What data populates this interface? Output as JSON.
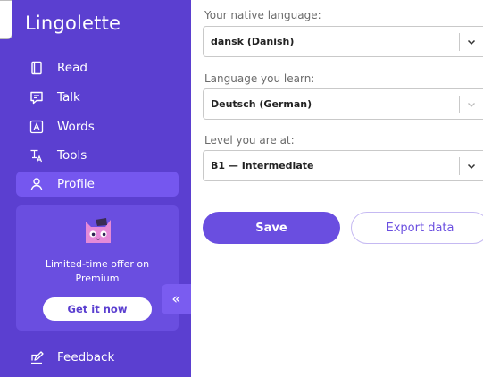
{
  "app": {
    "name": "Lingolette"
  },
  "sidebar": {
    "items": [
      {
        "label": "Read",
        "icon": "book-icon"
      },
      {
        "label": "Talk",
        "icon": "chat-icon"
      },
      {
        "label": "Words",
        "icon": "letter-a-icon"
      },
      {
        "label": "Tools",
        "icon": "translate-icon"
      },
      {
        "label": "Profile",
        "icon": "user-icon",
        "active": true
      }
    ],
    "feedback": {
      "label": "Feedback",
      "icon": "feedback-pen-icon"
    },
    "collapse_glyph": "«"
  },
  "promo": {
    "line1": "Limited-time offer on",
    "line2": "Premium",
    "button": "Get it now",
    "icon": "cat-mascot-icon"
  },
  "form": {
    "native": {
      "label": "Your native language:",
      "value": "dansk (Danish)"
    },
    "learn": {
      "label": "Language you learn:",
      "value": "Deutsch (German)"
    },
    "level": {
      "label": "Level you are at:",
      "value": "B1 — Intermediate"
    },
    "save_label": "Save",
    "export_label": "Export data"
  },
  "colors": {
    "sidebar": "#5b3fd0",
    "accent": "#6a4ee0",
    "active_item": "#7557ef"
  }
}
